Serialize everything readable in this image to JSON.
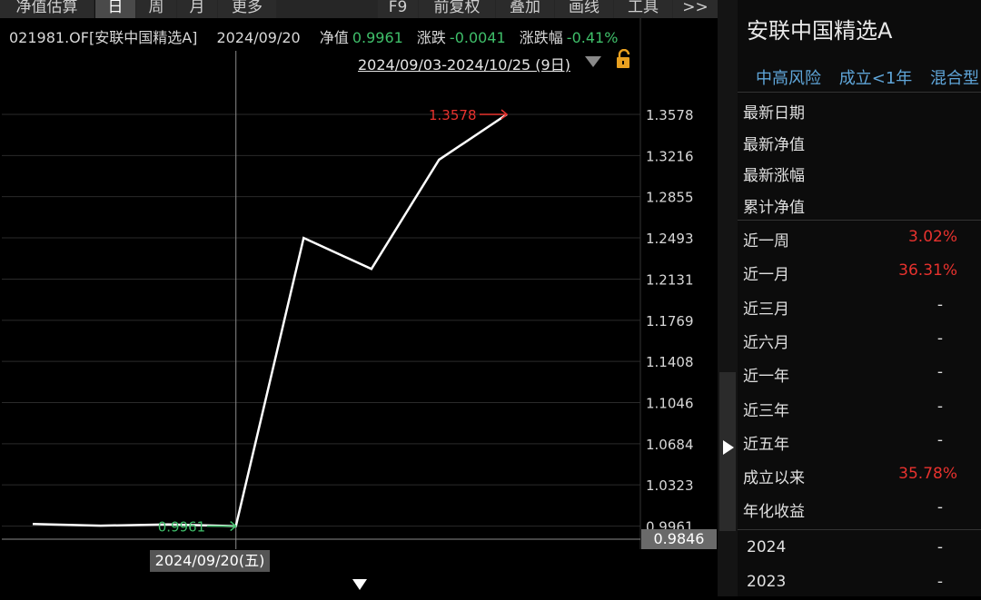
{
  "toolbar": {
    "items": [
      "净值估算",
      "日",
      "周",
      "月",
      "更多",
      "F9",
      "前复权",
      "叠加",
      "画线",
      "工具",
      ">>"
    ]
  },
  "info": {
    "code_name": "021981.OF[安联中国精选A]",
    "date": "2024/09/20",
    "nav_label": "净值",
    "nav_value": "0.9961",
    "change_label": "涨跌",
    "change_value": "-0.0041",
    "pct_label": "涨跌幅",
    "pct_value": "-0.41%"
  },
  "range_label": "2024/09/03-2024/10/25 (9日)",
  "chart_data": {
    "type": "line",
    "title": "",
    "xlabel": "",
    "ylabel": "",
    "y_ticks": [
      "1.3578",
      "1.3216",
      "1.2855",
      "1.2493",
      "1.2131",
      "1.1769",
      "1.1408",
      "1.1046",
      "1.0684",
      "1.0323",
      "0.9961"
    ],
    "ylim": [
      0.9846,
      1.3578
    ],
    "grid": true,
    "series": [
      {
        "values": [
          0.998,
          0.9965,
          0.9975,
          0.9961,
          1.2493,
          1.222,
          1.318,
          1.3578
        ]
      }
    ],
    "max_label": "1.3578",
    "min_label": "0.9961",
    "crosshair_value": "0.9846",
    "crosshair_date": "2024/09/20(五)",
    "colors": {
      "line": "#ffffff",
      "max": "#e8322e",
      "min": "#3fbf6a",
      "grid": "#2a2a2a"
    }
  },
  "panel": {
    "fund_name": "安联中国精选A",
    "tags": [
      "中高风险",
      "成立<1年",
      "混合型"
    ],
    "basic_rows": [
      {
        "label": "最新日期",
        "value": ""
      },
      {
        "label": "最新净值",
        "value": ""
      },
      {
        "label": "最新涨幅",
        "value": ""
      },
      {
        "label": "累计净值",
        "value": ""
      }
    ],
    "perf_rows": [
      {
        "label": "近一周",
        "value": "3.02%"
      },
      {
        "label": "近一月",
        "value": "36.31%"
      },
      {
        "label": "近三月",
        "value": "-"
      },
      {
        "label": "近六月",
        "value": "-"
      },
      {
        "label": "近一年",
        "value": "-"
      },
      {
        "label": "近三年",
        "value": "-"
      },
      {
        "label": "近五年",
        "value": "-"
      },
      {
        "label": "成立以来",
        "value": "35.78%"
      },
      {
        "label": "年化收益",
        "value": "-"
      }
    ],
    "year_rows": [
      {
        "label": "2024",
        "value": "-"
      },
      {
        "label": "2023",
        "value": "-"
      }
    ]
  }
}
